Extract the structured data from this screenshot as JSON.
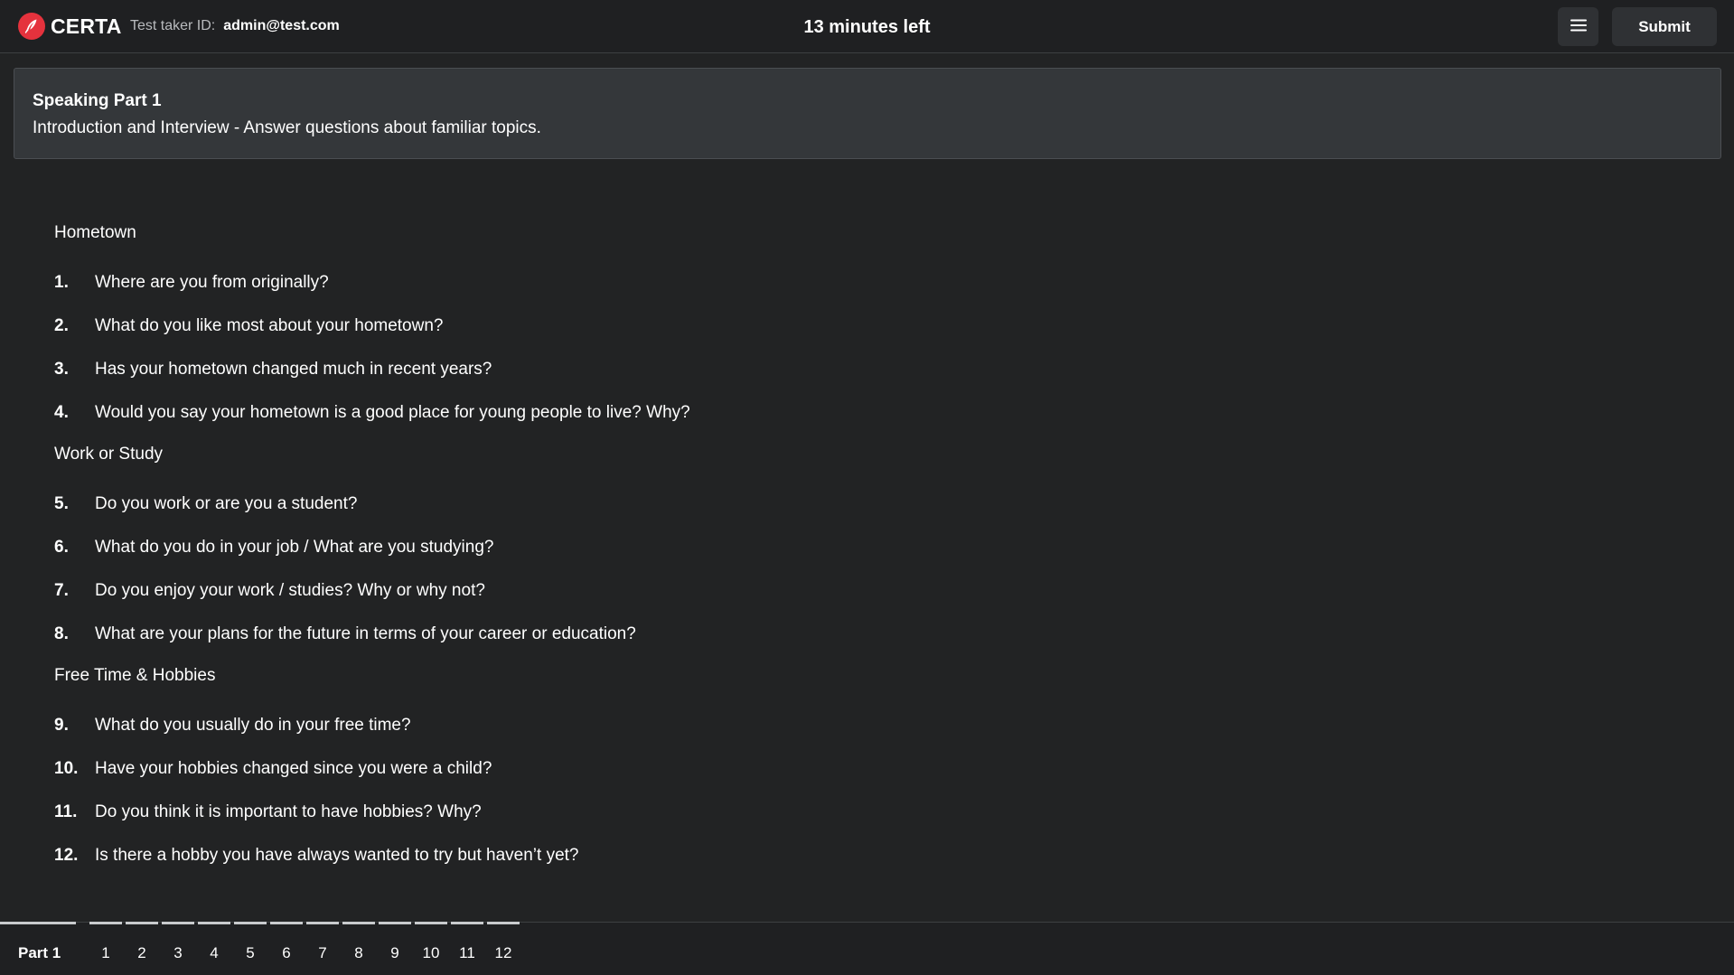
{
  "header": {
    "brand_name": "CERTA",
    "taker_label": "Test taker ID:",
    "taker_value": "admin@test.com",
    "timer": "13 minutes left",
    "submit_label": "Submit"
  },
  "part": {
    "title": "Speaking Part 1",
    "description": "Introduction and Interview - Answer questions about familiar topics."
  },
  "sections": [
    {
      "heading": "Hometown",
      "questions": [
        {
          "num": "1.",
          "text": "Where are you from originally?"
        },
        {
          "num": "2.",
          "text": "What do you like most about your hometown?"
        },
        {
          "num": "3.",
          "text": "Has your hometown changed much in recent years?"
        },
        {
          "num": "4.",
          "text": "Would you say your hometown is a good place for young people to live? Why?"
        }
      ]
    },
    {
      "heading": "Work or Study",
      "questions": [
        {
          "num": "5.",
          "text": "Do you work or are you a student?"
        },
        {
          "num": "6.",
          "text": "What do you do in your job / What are you studying?"
        },
        {
          "num": "7.",
          "text": "Do you enjoy your work / studies? Why or why not?"
        },
        {
          "num": "8.",
          "text": "What are your plans for the future in terms of your career or education?"
        }
      ]
    },
    {
      "heading": "Free Time & Hobbies",
      "questions": [
        {
          "num": "9.",
          "text": "What do you usually do in your free time?"
        },
        {
          "num": "10.",
          "text": "Have your hobbies changed since you were a child?"
        },
        {
          "num": "11.",
          "text": "Do you think it is important to have hobbies? Why?"
        },
        {
          "num": "12.",
          "text": "Is there a hobby you have always wanted to try but haven’t yet?"
        }
      ]
    }
  ],
  "bottom_nav": {
    "part_label": "Part 1",
    "items": [
      "1",
      "2",
      "3",
      "4",
      "5",
      "6",
      "7",
      "8",
      "9",
      "10",
      "11",
      "12"
    ]
  }
}
